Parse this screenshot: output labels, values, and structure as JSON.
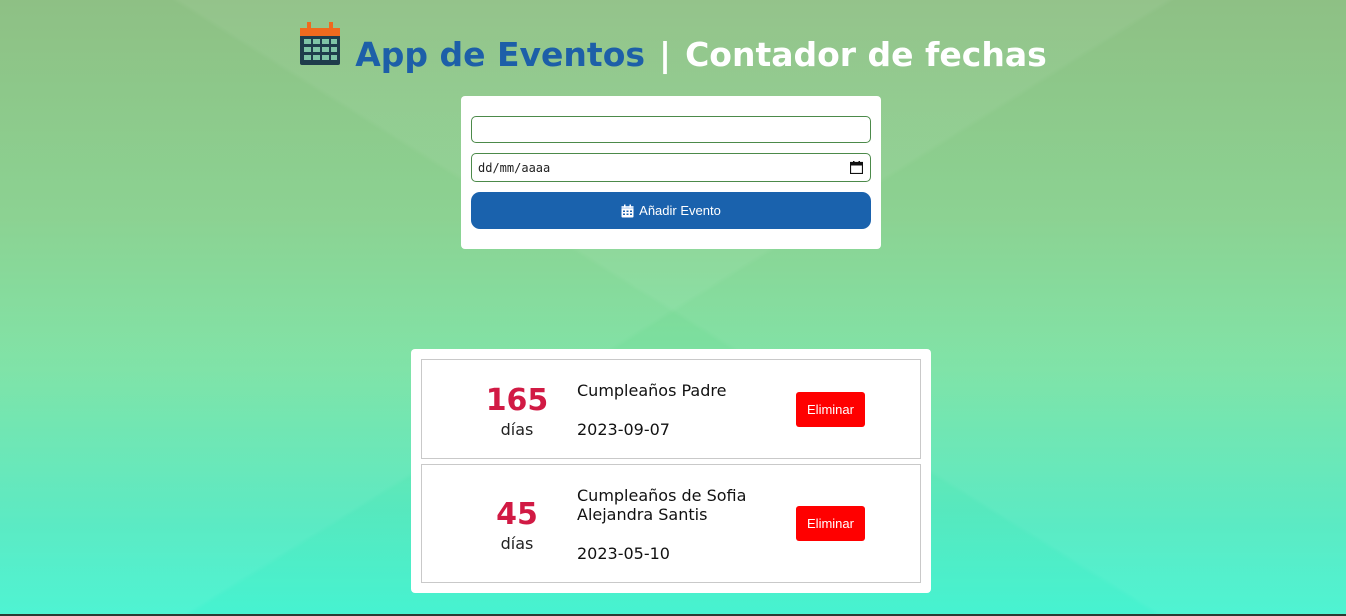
{
  "header": {
    "icon": "calendar-icon",
    "title_main": "App de Eventos",
    "separator": "|",
    "title_sub": "Contador de fechas"
  },
  "form": {
    "name_value": "",
    "date_placeholder": "dd/mm/aaaa",
    "add_button_label": "Añadir Evento",
    "add_button_icon": "calendar-icon"
  },
  "events": [
    {
      "days": "165",
      "days_label": "días",
      "name": "Cumpleaños Padre",
      "date": "2023-09-07",
      "delete_label": "Eliminar"
    },
    {
      "days": "45",
      "days_label": "días",
      "name": "Cumpleaños de Sofia Alejandra Santis",
      "date": "2023-05-10",
      "delete_label": "Eliminar"
    }
  ],
  "colors": {
    "title_blue": "#1d5fa8",
    "button_blue": "#1a62ad",
    "days_red": "#d11a44",
    "delete_red": "#ff0000"
  }
}
